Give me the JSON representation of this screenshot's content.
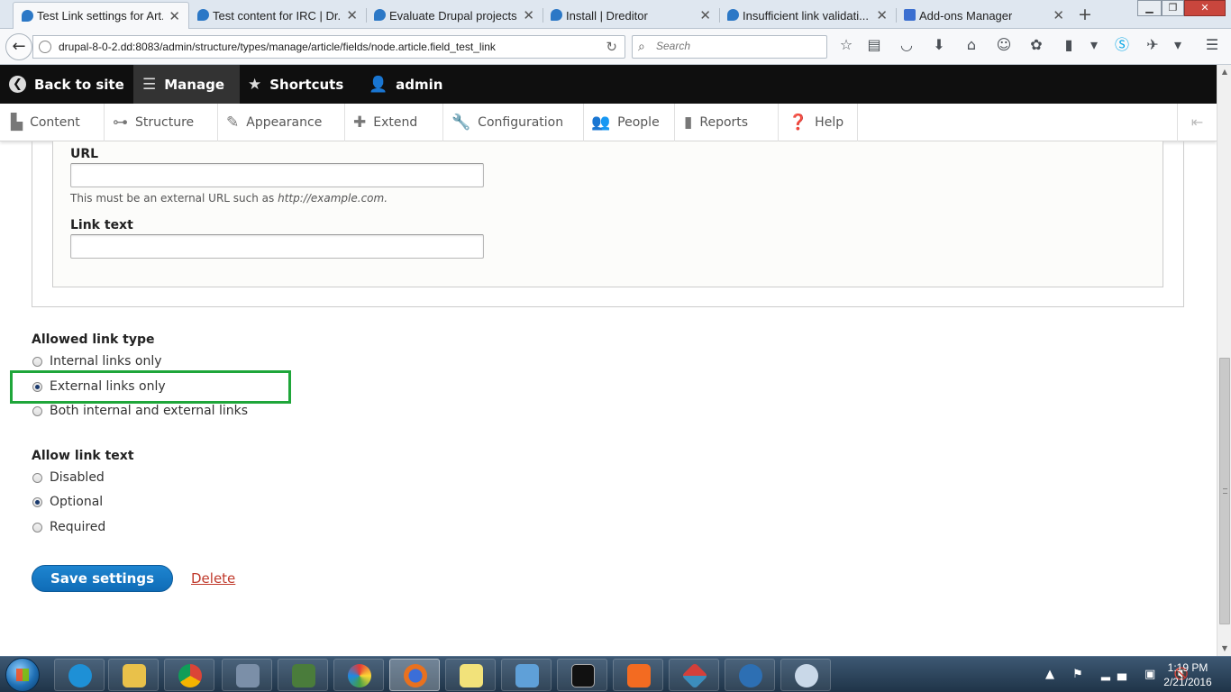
{
  "browser": {
    "tabs": [
      {
        "label": "Test Link settings for Art...",
        "active": true
      },
      {
        "label": "Test content for IRC | Dr...",
        "active": false
      },
      {
        "label": "Evaluate Drupal projects...",
        "active": false
      },
      {
        "label": "Install | Dreditor",
        "active": false
      },
      {
        "label": "Insufficient link validati...",
        "active": false
      },
      {
        "label": "Add-ons Manager",
        "active": false
      }
    ],
    "url": "drupal-8-0-2.dd:8083/admin/structure/types/manage/article/fields/node.article.field_test_link",
    "search_placeholder": "Search"
  },
  "toolbar": {
    "back_to_site": "Back to site",
    "manage": "Manage",
    "shortcuts": "Shortcuts",
    "user": "admin"
  },
  "tray": {
    "items": [
      "Content",
      "Structure",
      "Appearance",
      "Extend",
      "Configuration",
      "People",
      "Reports",
      "Help"
    ]
  },
  "form": {
    "url_label": "URL",
    "url_description_prefix": "This must be an external URL such as",
    "url_description_example": "http://example.com.",
    "link_text_label": "Link text",
    "allowed_link_type": {
      "title": "Allowed link type",
      "options": [
        "Internal links only",
        "External links only",
        "Both internal and external links"
      ],
      "selected_index": 1
    },
    "allow_link_text": {
      "title": "Allow link text",
      "options": [
        "Disabled",
        "Optional",
        "Required"
      ],
      "selected_index": 1
    },
    "save_label": "Save settings",
    "delete_label": "Delete"
  },
  "taskbar": {
    "time": "1:19 PM",
    "date": "2/21/2016"
  },
  "colors": {
    "highlight": "#1fa63a",
    "primary_button": "#0f6cb7",
    "delete_link": "#c0392b",
    "toolbar_bg": "#0f0f0f"
  }
}
